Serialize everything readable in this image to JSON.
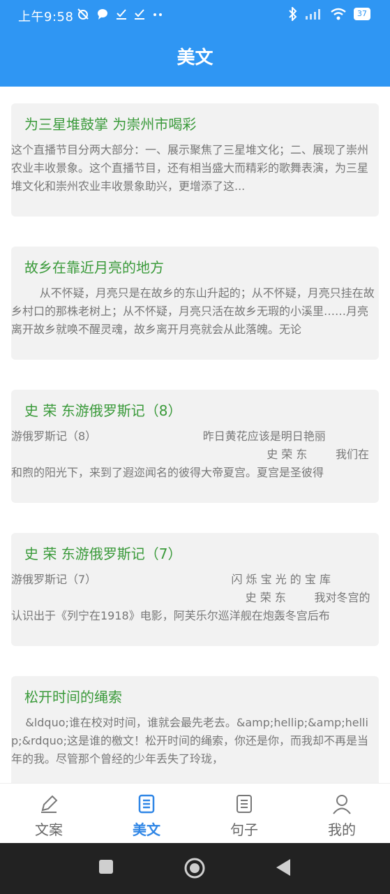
{
  "status_bar": {
    "time": "上午9:58",
    "battery": "37",
    "left_icons": [
      "alarm-off-icon",
      "chat-bubble-icon",
      "check-icon",
      "check-icon",
      "more-dots-icon"
    ],
    "right_icons": [
      "bluetooth-icon",
      "signal-icon",
      "wifi-icon",
      "battery-icon"
    ]
  },
  "header": {
    "title": "美文"
  },
  "articles": [
    {
      "title": "为三星堆鼓掌 为崇州市喝彩",
      "excerpt": "这个直播节目分两大部分：一、展示聚焦了三星堆文化；二、展现了崇州农业丰收景象。这个直播节目，还有相当盛大而精彩的歌舞表演，为三星堆文化和崇州农业丰收景象助兴，更增添了这..."
    },
    {
      "title": "故乡在靠近月亮的地方",
      "excerpt": "        从不怀疑，月亮只是在故乡的东山升起的；从不怀疑，月亮只挂在故乡村口的那株老树上；从不怀疑，月亮只活在故乡无瑕的小溪里……月亮离开故乡就唤不醒灵魂，故乡离开月亮就会从此落魄。无论"
    },
    {
      "title": "史 荣 东游俄罗斯记（8）",
      "excerpt": "游俄罗斯记（8）                              昨日黄花应该是明日艳丽\n                                                                        史 荣 东        我们在和煦的阳光下，来到了遐迩闻名的彼得大帝夏宫。夏宫是圣彼得"
    },
    {
      "title": "史 荣 东游俄罗斯记（7）",
      "excerpt": "游俄罗斯记（7）                                      闪 烁 宝 光 的 宝 库\n                                                                  史 荣 东        我对冬宫的认识出于《列宁在1918》电影，阿芙乐尔巡洋舰在炮轰冬宫后布"
    },
    {
      "title": "松开时间的绳索",
      "excerpt": "    &ldquo;谁在校对时间，谁就会最先老去。&amp;hellip;&amp;hellip;&rdquo;这是谁的檄文！松开时间的绳索，你还是你，而我却不再是当年的我。尽管那个曾经的少年丢失了玲珑，"
    }
  ],
  "tabs": [
    {
      "label": "文案",
      "icon": "pen-icon",
      "active": false
    },
    {
      "label": "美文",
      "icon": "document-icon",
      "active": true
    },
    {
      "label": "句子",
      "icon": "document-icon",
      "active": false
    },
    {
      "label": "我的",
      "icon": "user-icon",
      "active": false
    }
  ],
  "colors": {
    "primary": "#2f96f3",
    "tab_active": "#2f86e6",
    "article_title": "#3a9a3a",
    "card_bg": "#f2f2f2"
  }
}
